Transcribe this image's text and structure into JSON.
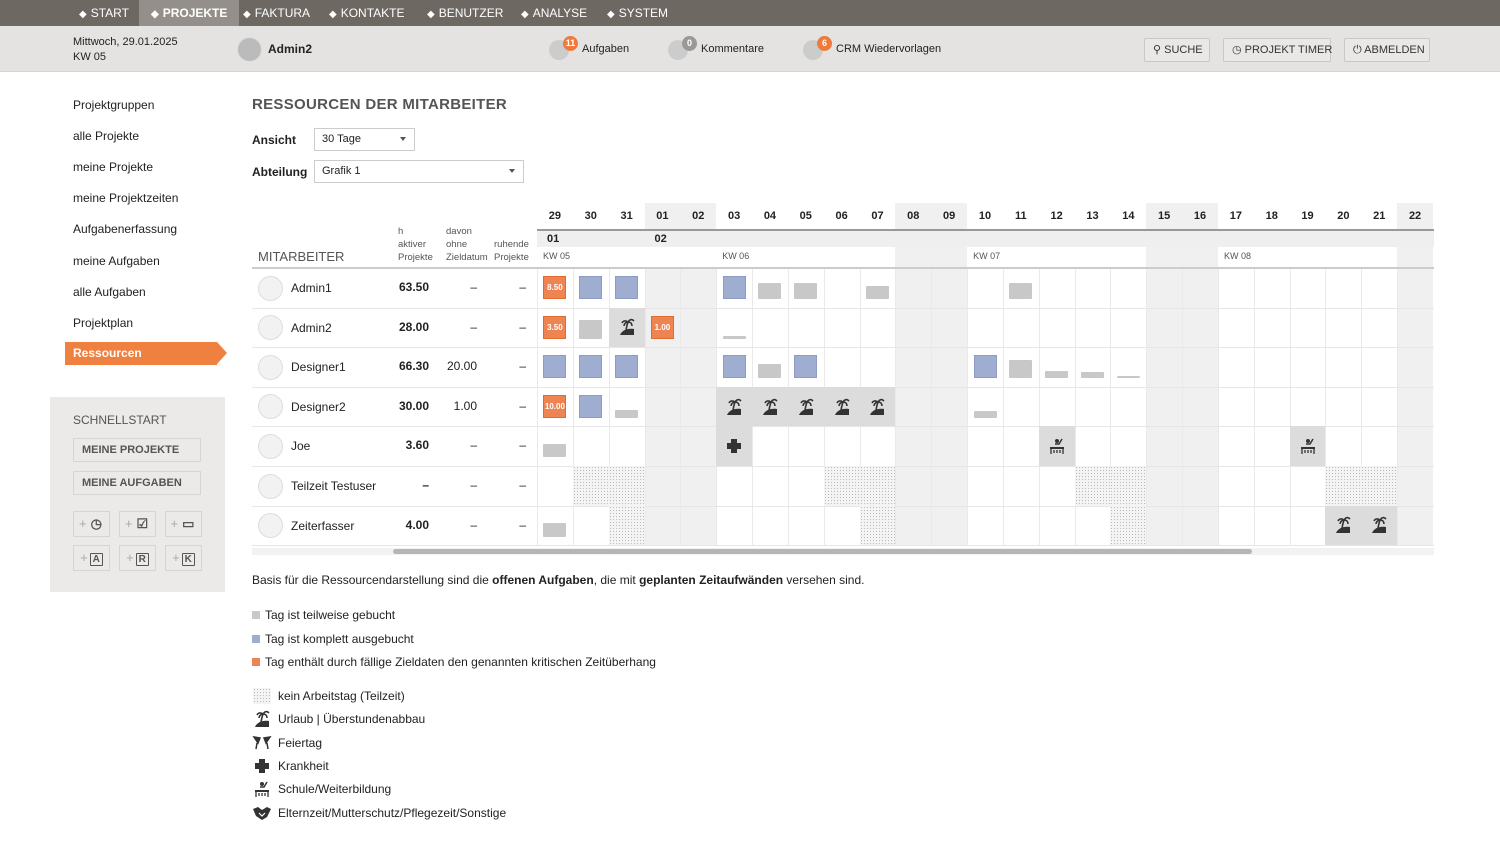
{
  "nav": [
    {
      "label": "START",
      "icon": "home-icon"
    },
    {
      "label": "PROJEKTE",
      "icon": "rocket-icon",
      "active": true
    },
    {
      "label": "FAKTURA",
      "icon": "invoice-icon"
    },
    {
      "label": "KONTAKTE",
      "icon": "contacts-icon"
    },
    {
      "label": "BENUTZER",
      "icon": "user-icon"
    },
    {
      "label": "ANALYSE",
      "icon": "chart-icon"
    },
    {
      "label": "SYSTEM",
      "icon": "gear-icon"
    }
  ],
  "header": {
    "date": "Mittwoch, 29.01.2025",
    "week": "KW 05",
    "user": "Admin2",
    "aufgaben": {
      "label": "Aufgaben",
      "count": "11"
    },
    "kommentare": {
      "label": "Kommentare",
      "count": "0"
    },
    "crm": {
      "label": "CRM Wiedervorlagen",
      "count": "6"
    },
    "search": "SUCHE",
    "timer": "PROJEKT TIMER",
    "logout": "ABMELDEN"
  },
  "sidebar": {
    "items": [
      "Projektgruppen",
      "alle Projekte",
      "meine Projekte",
      "meine Projektzeiten",
      "Aufgabenerfassung",
      "meine Aufgaben",
      "alle Aufgaben",
      "Projektplan",
      "Ressourcen"
    ],
    "active": "Ressourcen",
    "quick": {
      "title": "SCHNELLSTART",
      "buttons": [
        "MEINE PROJEKTE",
        "MEINE AUFGABEN"
      ],
      "icons": [
        {
          "name": "add-time-icon",
          "glyph": "◷"
        },
        {
          "name": "add-task-icon",
          "glyph": "☑"
        },
        {
          "name": "add-project-icon",
          "glyph": "▭"
        },
        {
          "name": "add-a-icon",
          "letter": "A"
        },
        {
          "name": "add-r-icon",
          "letter": "R"
        },
        {
          "name": "add-k-icon",
          "letter": "K"
        }
      ]
    }
  },
  "main": {
    "title": "RESSOURCEN DER MITARBEITER",
    "ansicht_label": "Ansicht",
    "ansicht": "30 Tage",
    "abteilung_label": "Abteilung",
    "abteilung": "Grafik 1",
    "cols": {
      "employee": "MITARBEITER",
      "h": "h\naktiver\nProjekte",
      "davon": "davon\nohne\nZieldatum",
      "ruhende": "ruhende\nProjekte"
    },
    "days": [
      "29",
      "30",
      "31",
      "01",
      "02",
      "03",
      "04",
      "05",
      "06",
      "07",
      "08",
      "09",
      "10",
      "11",
      "12",
      "13",
      "14",
      "15",
      "16",
      "17",
      "18",
      "19",
      "20",
      "21",
      "22"
    ],
    "weekend_days": [
      "01",
      "02",
      "08",
      "09",
      "15",
      "16",
      "22"
    ],
    "months": [
      {
        "label": "01",
        "start": "29"
      },
      {
        "label": "02",
        "start": "01"
      }
    ],
    "weeks": [
      {
        "label": "KW 05",
        "start": "29"
      },
      {
        "label": "KW 06",
        "start": "03"
      },
      {
        "label": "KW 07",
        "start": "10"
      },
      {
        "label": "KW 08",
        "start": "17"
      }
    ],
    "employees": [
      {
        "name": "Admin1",
        "h": "63.50",
        "davon": "–",
        "ruhende": "–",
        "cells": {
          "29": "o:8.50",
          "30": "f",
          "31": "f",
          "03": "f",
          "04": "p:0.7",
          "05": "p:0.7",
          "07": "p:0.55",
          "11": "p:0.7"
        }
      },
      {
        "name": "Admin2",
        "h": "28.00",
        "davon": "–",
        "ruhende": "–",
        "cells": {
          "29": "o:3.50",
          "30": "p:0.8",
          "31": "u",
          "01": "o:1.00",
          "03": "p:0.1"
        }
      },
      {
        "name": "Designer1",
        "h": "66.30",
        "davon": "20.00",
        "ruhende": "–",
        "cells": {
          "29": "f",
          "30": "f",
          "31": "f",
          "03": "f",
          "04": "p:0.6",
          "05": "f",
          "10": "f",
          "11": "p:0.8",
          "12": "p:0.3",
          "13": "p:0.25",
          "14": "p:0.05"
        }
      },
      {
        "name": "Designer2",
        "h": "30.00",
        "davon": "1.00",
        "ruhende": "–",
        "cells": {
          "29": "o:10.00",
          "30": "f",
          "31": "p:0.35",
          "03": "u",
          "04": "u",
          "05": "u",
          "06": "u",
          "07": "u",
          "10": "p:0.3"
        }
      },
      {
        "name": "Joe",
        "h": "3.60",
        "davon": "–",
        "ruhende": "–",
        "cells": {
          "29": "p:0.6",
          "03": "k",
          "12": "s",
          "19": "s"
        }
      },
      {
        "name": "Teilzeit Testuser",
        "h": "–",
        "davon": "–",
        "ruhende": "–",
        "cells": {
          "30": "n",
          "31": "n",
          "06": "n",
          "07": "n",
          "13": "n",
          "14": "n",
          "20": "n",
          "21": "n"
        }
      },
      {
        "name": "Zeiterfasser",
        "h": "4.00",
        "davon": "–",
        "ruhende": "–",
        "cells": {
          "29": "p:0.6",
          "31": "n",
          "07": "n",
          "14": "n",
          "20": "u",
          "21": "u"
        }
      }
    ],
    "note": [
      {
        "t": "Basis für die Ressourcendarstellung sind die "
      },
      {
        "t": "offenen Aufgaben",
        "b": true
      },
      {
        "t": ", die mit "
      },
      {
        "t": "geplanten Zeitaufwänden",
        "b": true
      },
      {
        "t": " versehen sind."
      }
    ],
    "legend_colors": [
      {
        "label": "Tag ist teilweise gebucht",
        "color": "#c8c8c8"
      },
      {
        "label": "Tag ist komplett ausgebucht",
        "color": "#9eadd0"
      },
      {
        "label": "Tag enthält durch fällige Zieldaten den genannten kritischen Zeitüberhang",
        "color": "#ef8453"
      }
    ],
    "legend_icons": [
      {
        "label": "kein Arbeitstag (Teilzeit)",
        "icon": "n"
      },
      {
        "label": "Urlaub | Überstundenabbau",
        "icon": "u"
      },
      {
        "label": "Feiertag",
        "icon": "h"
      },
      {
        "label": "Krankheit",
        "icon": "k"
      },
      {
        "label": "Schule/Weiterbildung",
        "icon": "s"
      },
      {
        "label": "Elternzeit/Mutterschutz/Pflegezeit/Sonstige",
        "icon": "e"
      }
    ]
  },
  "colors": {
    "partial": "#c8c8c8",
    "full": "#9eadd0",
    "overdue": "#ef8453",
    "accent": "#f08040"
  }
}
